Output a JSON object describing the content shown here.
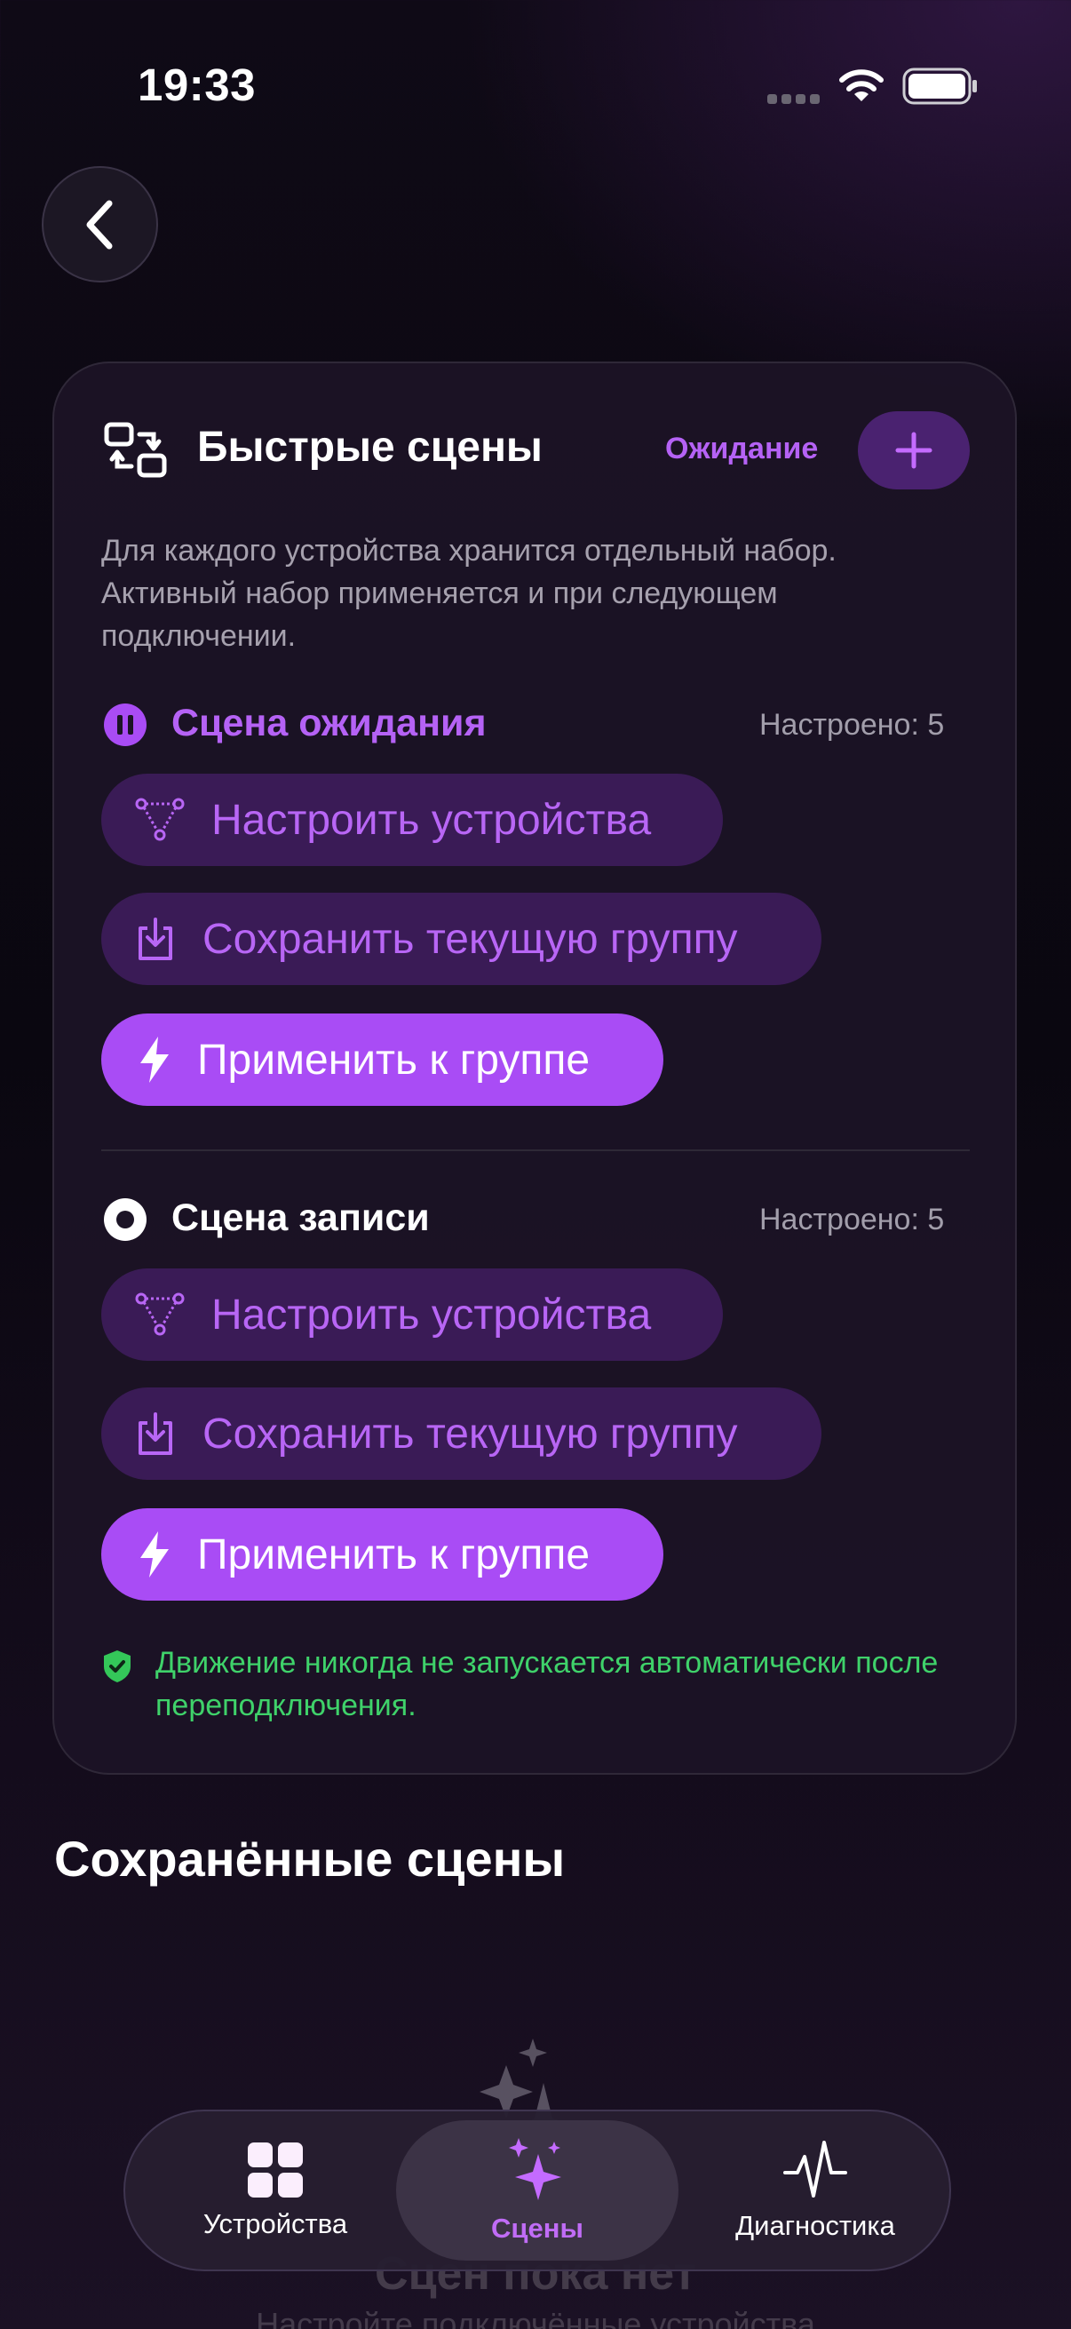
{
  "status_bar": {
    "time": "19:33"
  },
  "card": {
    "title": "Быстрые сцены",
    "mode_link": "Ожидание",
    "description": "Для каждого устройства хранится отдельный набор. Активный набор применяется и при следующем подключении.",
    "scenes": [
      {
        "title": "Сцена ожидания",
        "count": "Настроено: 5",
        "configure_label": "Настроить устройства",
        "save_label": "Сохранить текущую группу",
        "apply_label": "Применить к группе"
      },
      {
        "title": "Сцена записи",
        "count": "Настроено: 5",
        "configure_label": "Настроить устройства",
        "save_label": "Сохранить текущую группу",
        "apply_label": "Применить к группе"
      }
    ],
    "safety_note": "Движение никогда не запускается автоматически после переподключения."
  },
  "saved_section": {
    "title": "Сохранённые сцены",
    "empty_title": "Сцен пока нет",
    "empty_subtitle": "Настройте подключённые устройства"
  },
  "tabbar": {
    "tabs": [
      {
        "label": "Устройства",
        "icon": "grid-icon",
        "active": false
      },
      {
        "label": "Сцены",
        "icon": "sparkles-icon",
        "active": true
      },
      {
        "label": "Диагностика",
        "icon": "pulse-icon",
        "active": false
      }
    ]
  },
  "colors": {
    "accent": "#a94cf5",
    "accent_text": "#b866f5",
    "success": "#3fd26a"
  }
}
